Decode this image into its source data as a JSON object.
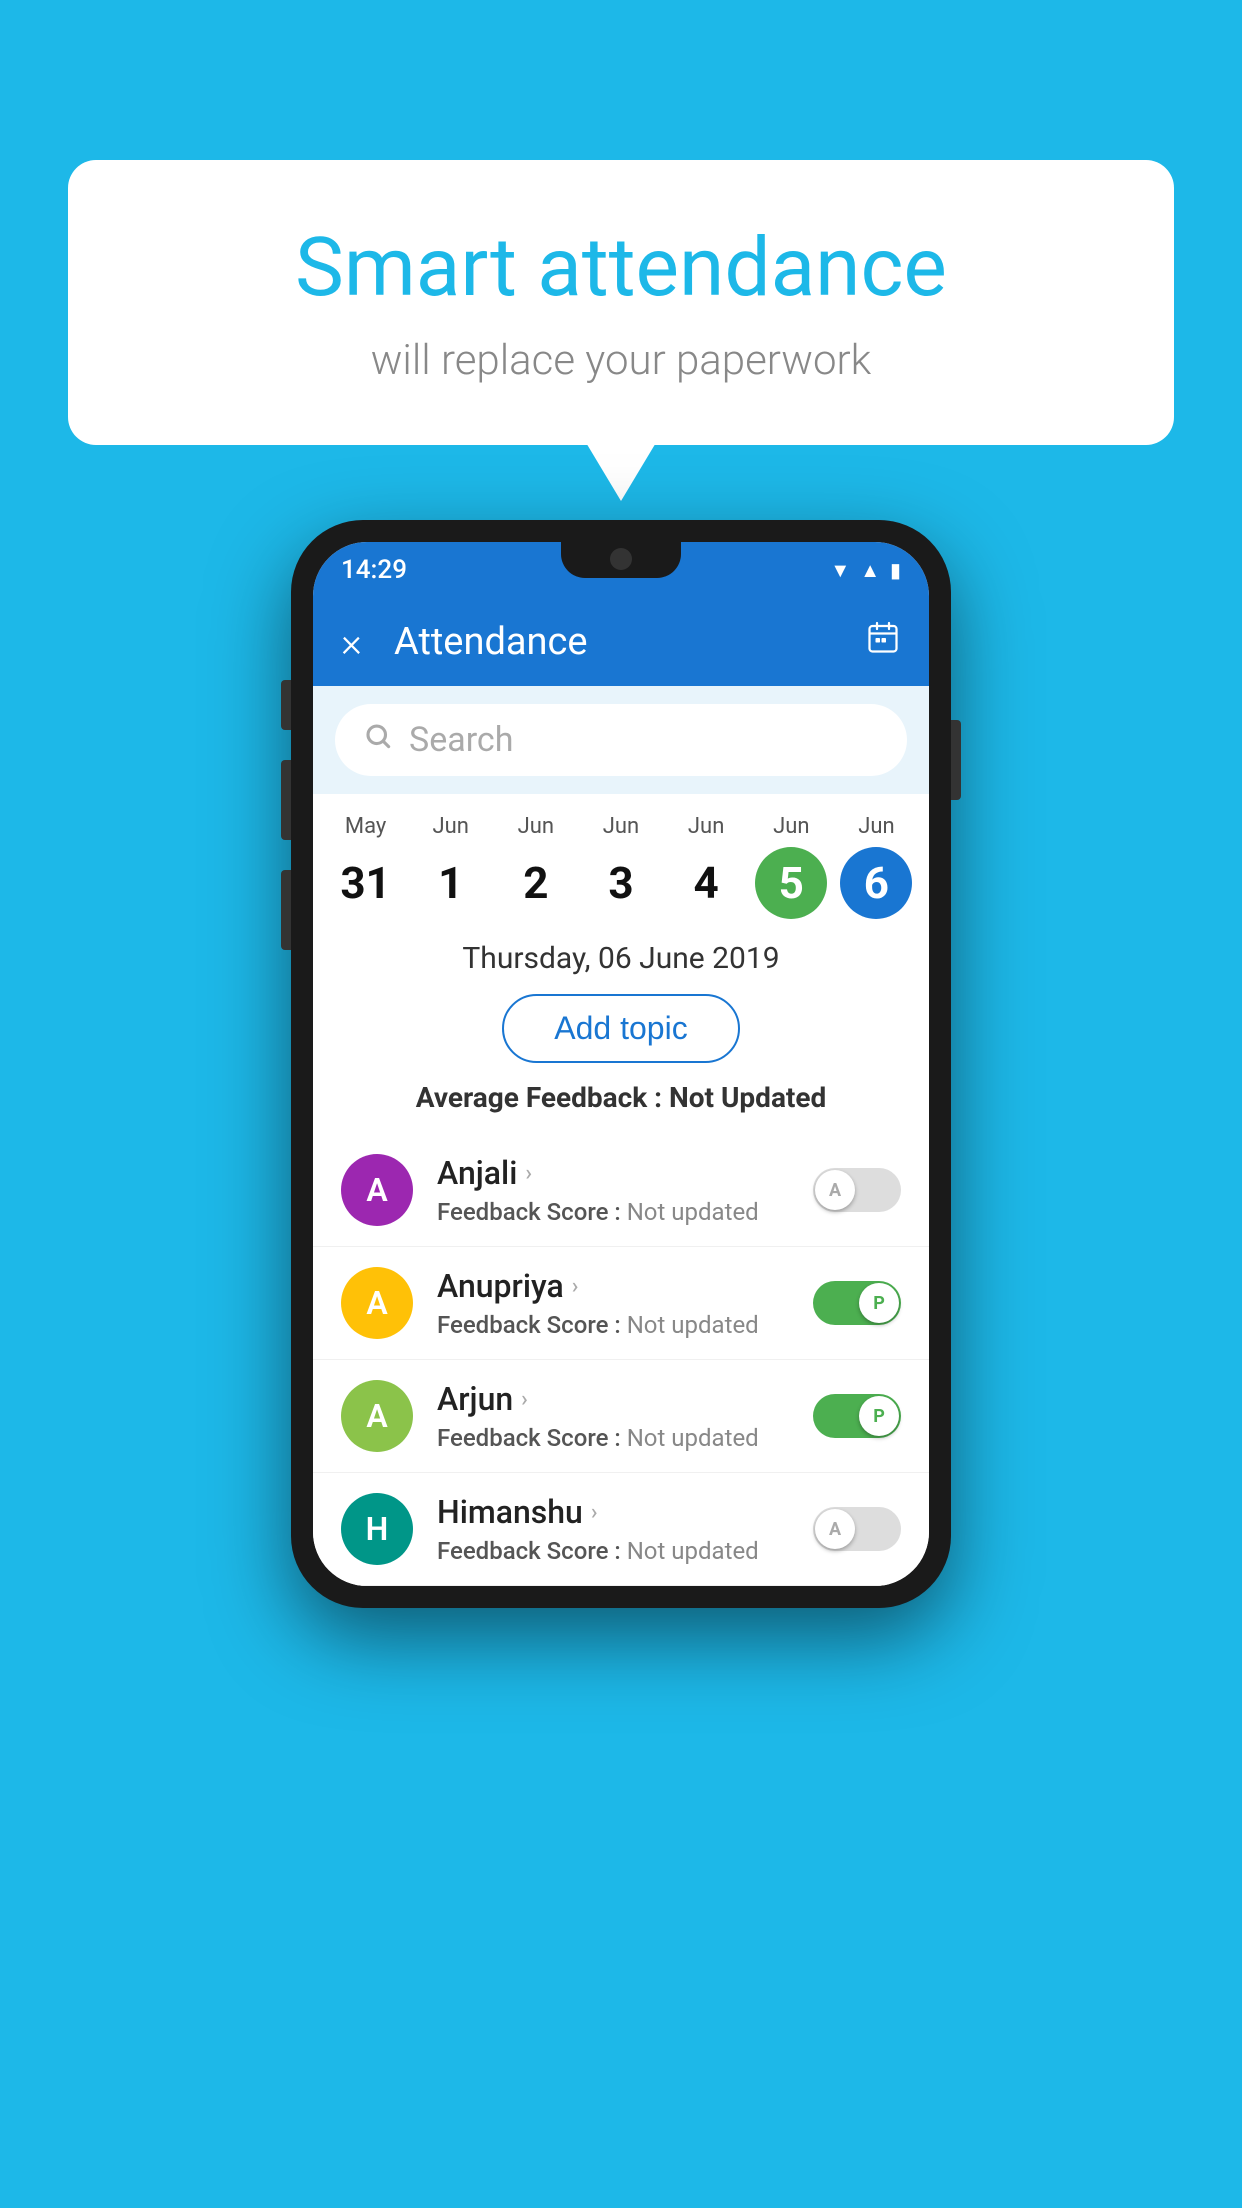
{
  "background_color": "#1db8e8",
  "bubble": {
    "title": "Smart attendance",
    "subtitle": "will replace your paperwork"
  },
  "phone": {
    "status_bar": {
      "time": "14:29",
      "icons": [
        "wifi",
        "signal",
        "battery"
      ]
    },
    "app_bar": {
      "title": "Attendance",
      "close_label": "×",
      "calendar_icon": "📅"
    },
    "search": {
      "placeholder": "Search"
    },
    "calendar": {
      "days": [
        {
          "month": "May",
          "date": "31",
          "state": "normal"
        },
        {
          "month": "Jun",
          "date": "1",
          "state": "normal"
        },
        {
          "month": "Jun",
          "date": "2",
          "state": "normal"
        },
        {
          "month": "Jun",
          "date": "3",
          "state": "normal"
        },
        {
          "month": "Jun",
          "date": "4",
          "state": "normal"
        },
        {
          "month": "Jun",
          "date": "5",
          "state": "today"
        },
        {
          "month": "Jun",
          "date": "6",
          "state": "selected"
        }
      ]
    },
    "selected_date_label": "Thursday, 06 June 2019",
    "add_topic_label": "Add topic",
    "avg_feedback_label": "Average Feedback :",
    "avg_feedback_value": "Not Updated",
    "students": [
      {
        "name": "Anjali",
        "avatar_letter": "A",
        "avatar_color": "purple",
        "feedback_label": "Feedback Score :",
        "feedback_value": "Not updated",
        "toggle_state": "off",
        "toggle_letter": "A"
      },
      {
        "name": "Anupriya",
        "avatar_letter": "A",
        "avatar_color": "yellow",
        "feedback_label": "Feedback Score :",
        "feedback_value": "Not updated",
        "toggle_state": "on",
        "toggle_letter": "P"
      },
      {
        "name": "Arjun",
        "avatar_letter": "A",
        "avatar_color": "light-green",
        "feedback_label": "Feedback Score :",
        "feedback_value": "Not updated",
        "toggle_state": "on",
        "toggle_letter": "P"
      },
      {
        "name": "Himanshu",
        "avatar_letter": "H",
        "avatar_color": "teal",
        "feedback_label": "Feedback Score :",
        "feedback_value": "Not updated",
        "toggle_state": "off",
        "toggle_letter": "A"
      }
    ]
  }
}
